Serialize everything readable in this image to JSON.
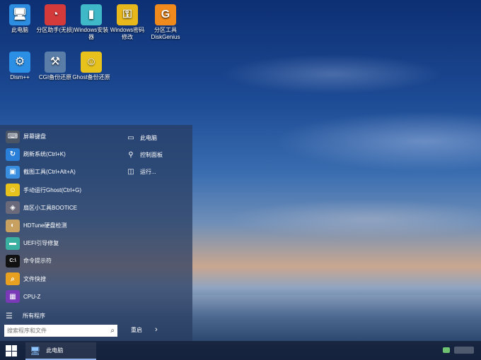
{
  "desktop_icons": [
    {
      "label": "此电脑",
      "glyph": "🖥",
      "color": "#2d8de0"
    },
    {
      "label": "分区助手(无损)",
      "glyph": "◔",
      "color": "#d43a3a"
    },
    {
      "label": "Windows安装器",
      "glyph": "▮",
      "color": "#3fb8c8"
    },
    {
      "label": "Windows密码修改",
      "glyph": "⚿",
      "color": "#e6b81c"
    },
    {
      "label": "分区工具DiskGenius",
      "glyph": "G",
      "color": "#f08a1c"
    },
    {
      "label": "Dism++",
      "glyph": "⚙",
      "color": "#2c8fe6"
    },
    {
      "label": "CGI备份还原",
      "glyph": "⚒",
      "color": "#5a7ea8"
    },
    {
      "label": "Ghost备份还原",
      "glyph": "☺",
      "color": "#e8c21c"
    }
  ],
  "start_menu": {
    "items": [
      {
        "label": "屏幕键盘",
        "glyph": "⌨",
        "color": "#4a5566"
      },
      {
        "label": "刷新系统(Ctrl+K)",
        "glyph": "↻",
        "color": "#2a7fd8"
      },
      {
        "label": "截图工具(Ctrl+Alt+A)",
        "glyph": "▣",
        "color": "#3a8ee0"
      },
      {
        "label": "手动运行Ghost(Ctrl+G)",
        "glyph": "☺",
        "color": "#e8c21c"
      },
      {
        "label": "扇区小工具BOOTICE",
        "glyph": "◈",
        "color": "#6a6a7a"
      },
      {
        "label": "HDTune硬盘检测",
        "glyph": "◐",
        "color": "#c8a060"
      },
      {
        "label": "UEFI引导修复",
        "glyph": "▬",
        "color": "#3ab0a0"
      },
      {
        "label": "命令提示符",
        "glyph": "C:\\",
        "color": "#111111"
      },
      {
        "label": "文件快搜",
        "glyph": "⌕",
        "color": "#e8a020"
      },
      {
        "label": "CPU-Z",
        "glyph": "▦",
        "color": "#7a3ab8"
      }
    ],
    "right_items": [
      {
        "label": "此电脑",
        "glyph": "▭"
      },
      {
        "label": "控制面板",
        "glyph": "⚲"
      },
      {
        "label": "运行...",
        "glyph": "◫"
      }
    ],
    "all_programs": "所有程序",
    "search_placeholder": "搜索程序和文件",
    "restart": "重启"
  },
  "taskbar": {
    "active_item": "此电脑"
  }
}
